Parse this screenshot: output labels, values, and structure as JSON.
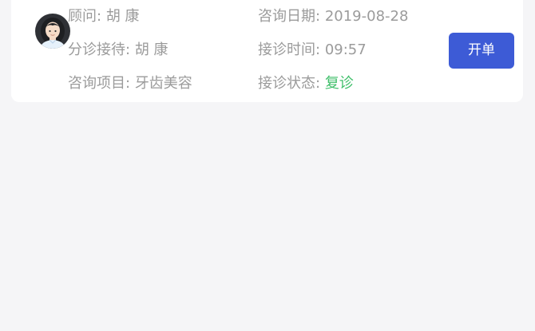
{
  "consultation": {
    "advisor_label": "顾问:",
    "advisor_name": "胡 康",
    "date_label": "咨询日期:",
    "date_value": "2019-08-28",
    "reception_label": "分诊接待:",
    "reception_name": "胡 康",
    "time_label": "接诊时间:",
    "time_value": "09:57",
    "project_label": "咨询项目:",
    "project_value": "牙齿美容",
    "status_label": "接诊状态:",
    "status_value": "复诊",
    "open_button_label": "开单"
  },
  "colors": {
    "page_background": "#f5f5f7",
    "card_background": "#ffffff",
    "label_text": "#9b9b9b",
    "status_green": "#3fbf6a",
    "button_blue": "#3d5bd6"
  },
  "icons": {
    "avatar": "user-avatar-icon"
  }
}
